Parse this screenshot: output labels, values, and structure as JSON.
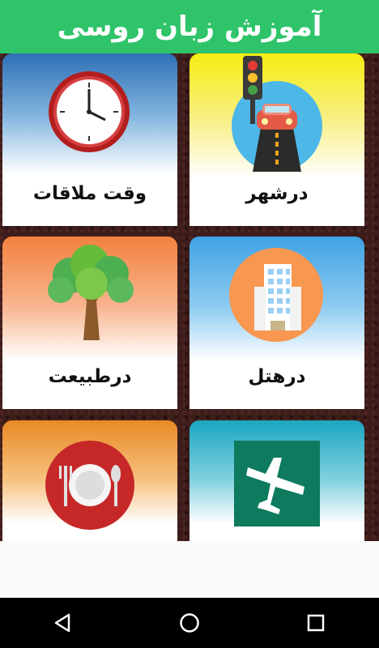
{
  "app": {
    "title": "آموزش زبان روسی"
  },
  "cards": [
    {
      "label": "وقت ملاقات",
      "icon": "clock-icon"
    },
    {
      "label": "درشهر",
      "icon": "traffic-car-icon"
    },
    {
      "label": "درطبیعت",
      "icon": "tree-icon"
    },
    {
      "label": "درهتل",
      "icon": "hotel-building-icon"
    },
    {
      "label": "",
      "icon": "plate-cutlery-icon"
    },
    {
      "label": "",
      "icon": "airplane-icon"
    }
  ],
  "navbar": {
    "buttons": [
      "back-icon",
      "home-icon",
      "recents-icon"
    ]
  },
  "colors": {
    "header": "#2fc46a",
    "grid_bg": "#3d1d1b",
    "navbar": "#000000"
  }
}
